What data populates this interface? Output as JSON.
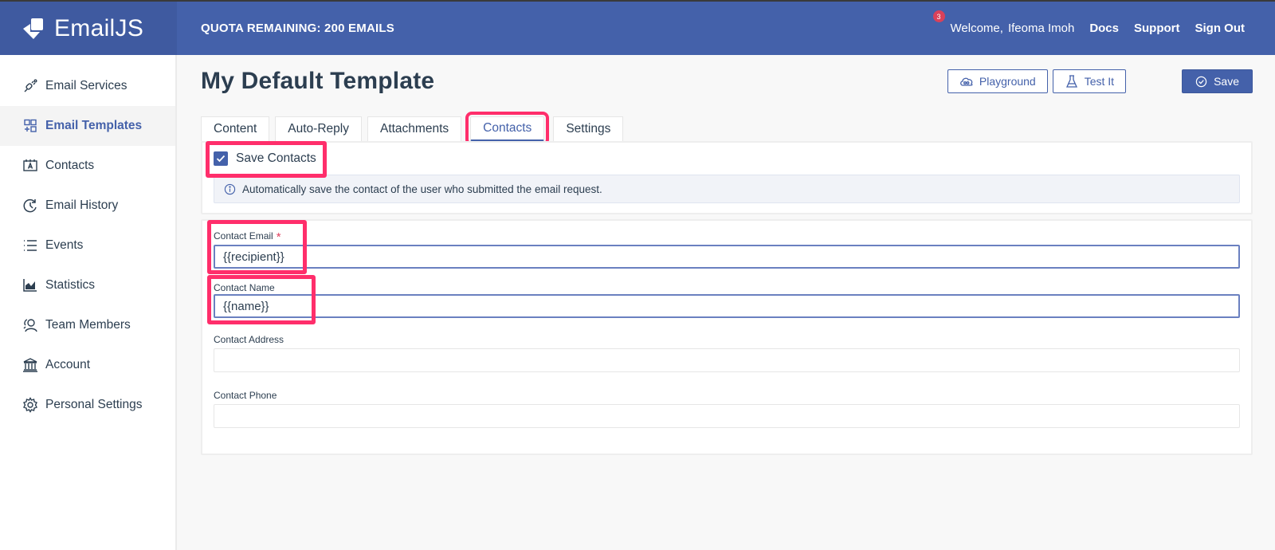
{
  "header": {
    "brand": "EmailJS",
    "quota": "QUOTA REMAINING: 200 EMAILS",
    "notification_count": "3",
    "welcome": "Welcome,",
    "user_name": "Ifeoma Imoh",
    "links": [
      "Docs",
      "Support",
      "Sign Out"
    ]
  },
  "sidebar": {
    "items": [
      {
        "label": "Email Services",
        "icon": "plug-icon"
      },
      {
        "label": "Email Templates",
        "icon": "templates-icon",
        "active": true
      },
      {
        "label": "Contacts",
        "icon": "contacts-icon"
      },
      {
        "label": "Email History",
        "icon": "history-icon"
      },
      {
        "label": "Events",
        "icon": "list-icon"
      },
      {
        "label": "Statistics",
        "icon": "chart-icon"
      },
      {
        "label": "Team Members",
        "icon": "team-icon"
      },
      {
        "label": "Account",
        "icon": "bank-icon"
      },
      {
        "label": "Personal Settings",
        "icon": "gear-icon"
      }
    ]
  },
  "page": {
    "title": "My Default Template",
    "buttons": {
      "playground": "Playground",
      "test_it": "Test It",
      "save": "Save"
    },
    "tabs": [
      "Content",
      "Auto-Reply",
      "Attachments",
      "Contacts",
      "Settings"
    ],
    "active_tab": "Contacts"
  },
  "contacts": {
    "save_contacts_label": "Save Contacts",
    "save_contacts_checked": true,
    "info_text": "Automatically save the contact of the user who submitted the email request.",
    "fields": [
      {
        "label": "Contact Email",
        "required": true,
        "value": "{{recipient}}"
      },
      {
        "label": "Contact Name",
        "required": false,
        "value": "{{name}}"
      },
      {
        "label": "Contact Address",
        "required": false,
        "value": ""
      },
      {
        "label": "Contact Phone",
        "required": false,
        "value": ""
      }
    ],
    "required_marker": "*"
  },
  "colors": {
    "brand": "#4461aa",
    "highlight": "#ff2e6b",
    "required": "#e0415f",
    "badge": "#d9415a"
  }
}
